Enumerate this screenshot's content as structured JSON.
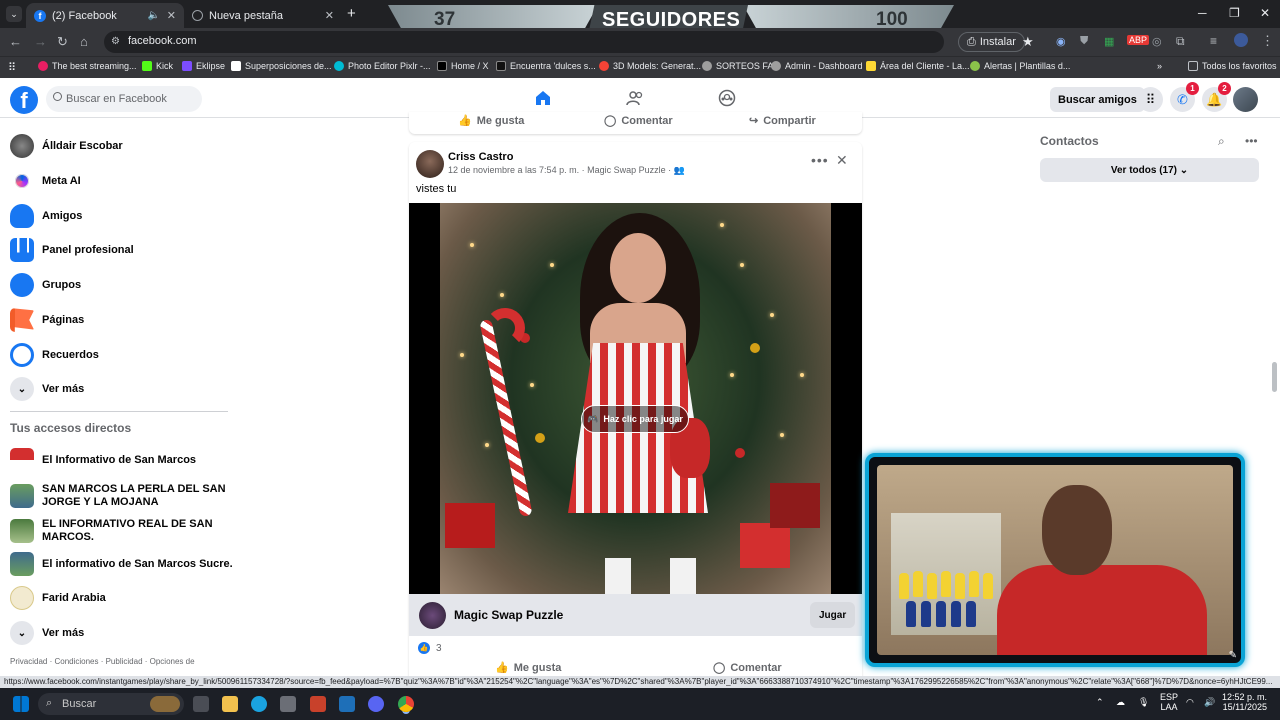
{
  "browser": {
    "tabs": [
      {
        "label": "(2) Facebook"
      },
      {
        "label": "Nueva pestaña"
      }
    ],
    "new_tab": "+",
    "url": "facebook.com",
    "install_label": "Instalar",
    "bookmarks": [
      "The best streaming...",
      "Kick",
      "Eklipse",
      "Superposiciones de...",
      "Photo Editor Pixlr -...",
      "Home / X",
      "Encuentra 'dulces s...",
      "3D Models: Generat...",
      "SORTEOS FA",
      "Admin - Dashboard",
      "Área del Cliente - La...",
      "Alertas | Plantillas d..."
    ],
    "all_favorites": "Todos los favoritos"
  },
  "overlay": {
    "left_num": "37",
    "text": "SEGUIDORES",
    "right_num": "100"
  },
  "fb": {
    "search_placeholder": "Buscar en Facebook",
    "find_friends": "Buscar amigos",
    "messenger_badge": "1",
    "notif_badge": "2"
  },
  "sidebar": {
    "items": [
      {
        "label": "Álldair Escobar"
      },
      {
        "label": "Meta AI"
      },
      {
        "label": "Amigos"
      },
      {
        "label": "Panel profesional"
      },
      {
        "label": "Grupos"
      },
      {
        "label": "Páginas"
      },
      {
        "label": "Recuerdos"
      },
      {
        "label": "Ver más"
      }
    ],
    "shortcuts_title": "Tus accesos directos",
    "shortcuts": [
      {
        "label": "El Informativo de San Marcos"
      },
      {
        "label": "SAN MARCOS LA PERLA DEL SAN JORGE Y LA MOJANA"
      },
      {
        "label": "EL INFORMATIVO REAL DE SAN MARCOS."
      },
      {
        "label": "El informativo de San Marcos Sucre."
      },
      {
        "label": "Farid Arabia"
      },
      {
        "label": "Ver más"
      }
    ],
    "footer": "Privacidad · Condiciones · Publicidad · Opciones de"
  },
  "prev_post": {
    "like": "Me gusta",
    "comment": "Comentar",
    "share": "Compartir"
  },
  "post": {
    "author": "Criss Castro",
    "meta": "12 de noviembre a las 7:54 p. m. · Magic Swap Puzzle ·",
    "text": "vistes tu",
    "play_overlay": "Haz clic para jugar",
    "game_name": "Magic Swap Puzzle",
    "game_button": "Jugar",
    "like_count": "3",
    "like": "Me gusta",
    "comment": "Comentar"
  },
  "contacts": {
    "title": "Contactos",
    "see_all": "Ver todos (17)"
  },
  "status_url": "https://www.facebook.com/instantgames/play/share_by_link/500961157334728/?source=fb_feed&payload=%7B\"quiz\"%3A%7B\"id\"%3A\"215254\"%2C\"language\"%3A\"es\"%7D%2C\"shared\"%3A%7B\"player_id\"%3A\"6663388710374910\"%2C\"timestamp\"%3A1762995226585%2C\"from\"%3A\"anonymous\"%2C\"relate\"%3A[\"668\"]%7D%7D&nonce=6yhHJtCE99...",
  "taskbar": {
    "search": "Buscar",
    "lang1": "ESP",
    "lang2": "LAA",
    "time": "12:52 p. m.",
    "date": "15/11/2025"
  }
}
